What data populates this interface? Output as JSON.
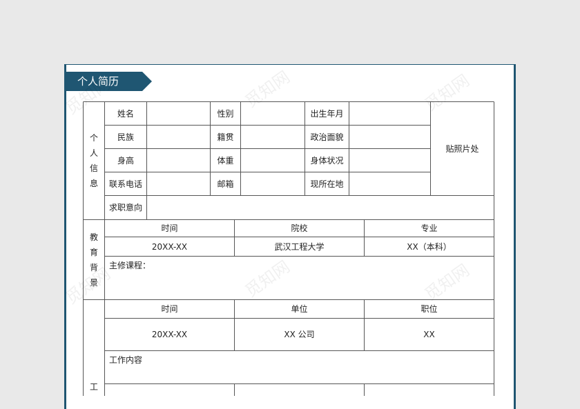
{
  "title": "个人简历",
  "colors": {
    "accent": "#1f5672",
    "background": "#e9e9e9",
    "line": "#555555"
  },
  "watermark": "觅知网",
  "personal": {
    "section_label": "个人信息",
    "rows": [
      {
        "l1": "姓名",
        "v1": "",
        "l2": "性别",
        "v2": "",
        "l3": "出生年月",
        "v3": ""
      },
      {
        "l1": "民族",
        "v1": "",
        "l2": "籍贯",
        "v2": "",
        "l3": "政治面貌",
        "v3": ""
      },
      {
        "l1": "身高",
        "v1": "",
        "l2": "体重",
        "v2": "",
        "l3": "身体状况",
        "v3": ""
      },
      {
        "l1": "联系电话",
        "v1": "",
        "l2": "邮箱",
        "v2": "",
        "l3": "现所在地",
        "v3": ""
      }
    ],
    "photo_label": "贴照片处",
    "objective_label": "求职意向",
    "objective_value": ""
  },
  "education": {
    "section_label": "教育背景",
    "headers": [
      "时间",
      "院校",
      "专业"
    ],
    "row": [
      "20XX-XX",
      "武汉工程大学",
      "XX（本科）"
    ],
    "courses_label": "主修课程："
  },
  "work": {
    "section_label": "工",
    "headers": [
      "时间",
      "单位",
      "职位"
    ],
    "row": [
      "20XX-XX",
      "XX 公司",
      "XX"
    ],
    "content_label": "工作内容"
  }
}
